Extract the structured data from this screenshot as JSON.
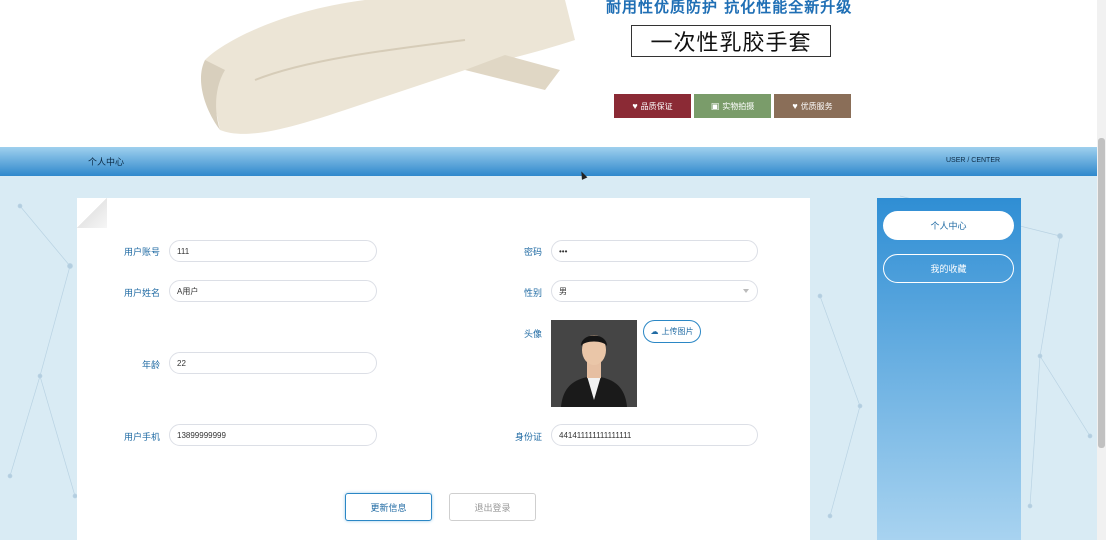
{
  "banner": {
    "slogan": "耐用性优质防护  抗化性能全新升级",
    "product_title": "一次性乳胶手套",
    "badges": [
      {
        "label": "品质保证",
        "icon": "heart-icon",
        "color": "#8b2a35"
      },
      {
        "label": "实物拍摄",
        "icon": "camera-icon",
        "color": "#7a9c6a"
      },
      {
        "label": "优质服务",
        "icon": "heart-icon",
        "color": "#8a6e58"
      }
    ]
  },
  "navbar": {
    "left_title": "个人中心",
    "right_title": "USER / CENTER"
  },
  "form": {
    "account": {
      "label": "用户账号",
      "value": "111"
    },
    "password": {
      "label": "密码",
      "value": "•••"
    },
    "name": {
      "label": "用户姓名",
      "value": "A用户"
    },
    "gender": {
      "label": "性别",
      "value": "男"
    },
    "avatar": {
      "label": "头像",
      "upload_label": "上传图片"
    },
    "age": {
      "label": "年龄",
      "value": "22"
    },
    "phone": {
      "label": "用户手机",
      "value": "13899999999"
    },
    "id_card": {
      "label": "身份证",
      "value": "441411111111111111"
    },
    "update_button": "更新信息",
    "logout_button": "退出登录"
  },
  "sidebar": {
    "items": [
      {
        "label": "个人中心",
        "active": true
      },
      {
        "label": "我的收藏",
        "active": false
      }
    ]
  },
  "colors": {
    "accent": "#2b87c5",
    "label_text": "#1f6aa3",
    "page_bg": "#d9ebf4"
  }
}
